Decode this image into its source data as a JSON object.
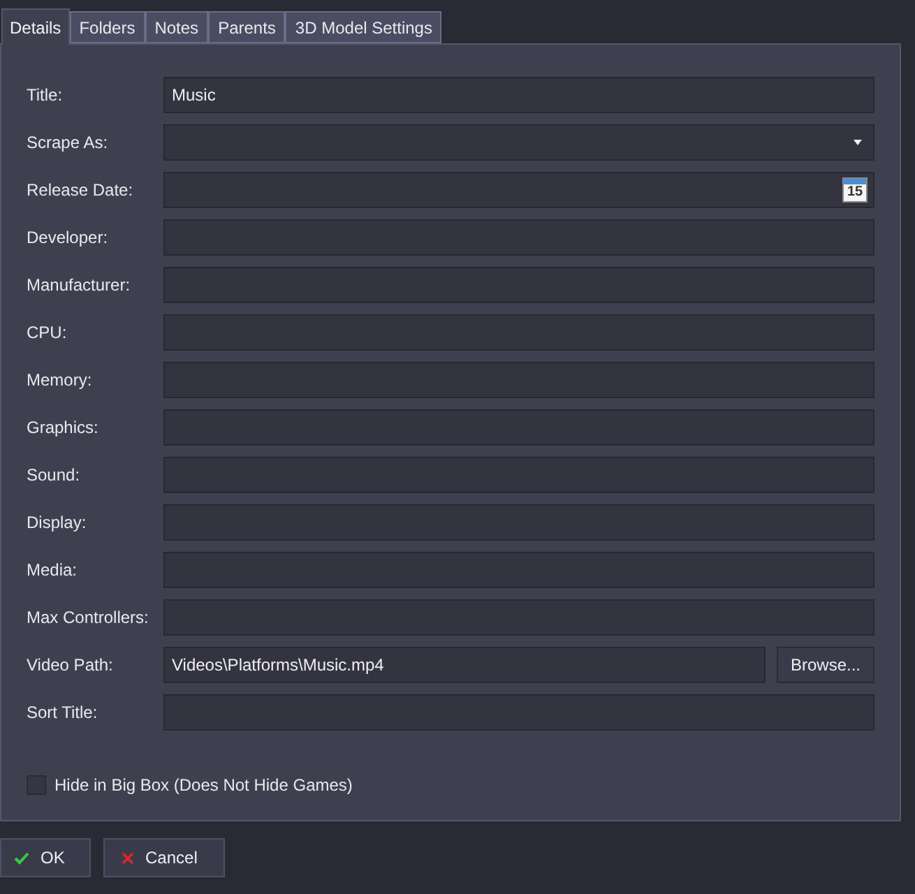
{
  "tabs": [
    {
      "label": "Details",
      "selected": true
    },
    {
      "label": "Folders",
      "selected": false
    },
    {
      "label": "Notes",
      "selected": false
    },
    {
      "label": "Parents",
      "selected": false
    },
    {
      "label": "3D Model Settings",
      "selected": false
    }
  ],
  "fields": [
    {
      "kind": "text",
      "label": "Title:",
      "value": "Music"
    },
    {
      "kind": "dropdown",
      "label": "Scrape As:"
    },
    {
      "kind": "date",
      "label": "Release Date:",
      "calendar_day": "15"
    },
    {
      "kind": "text",
      "label": "Developer:"
    },
    {
      "kind": "text",
      "label": "Manufacturer:"
    },
    {
      "kind": "text",
      "label": "CPU:"
    },
    {
      "kind": "text",
      "label": "Memory:"
    },
    {
      "kind": "text",
      "label": "Graphics:"
    },
    {
      "kind": "text",
      "label": "Sound:"
    },
    {
      "kind": "text",
      "label": "Display:"
    },
    {
      "kind": "text",
      "label": "Media:"
    },
    {
      "kind": "text",
      "label": "Max Controllers:"
    },
    {
      "kind": "browse",
      "label": "Video Path:",
      "value": "Videos\\Platforms\\Music.mp4",
      "button": "Browse..."
    },
    {
      "kind": "text",
      "label": "Sort Title:"
    }
  ],
  "hide_checkbox": {
    "label": "Hide in Big Box (Does Not Hide Games)",
    "checked": false
  },
  "buttons": [
    {
      "kind": "ok",
      "label": "OK"
    },
    {
      "kind": "cancel",
      "label": "Cancel"
    }
  ]
}
